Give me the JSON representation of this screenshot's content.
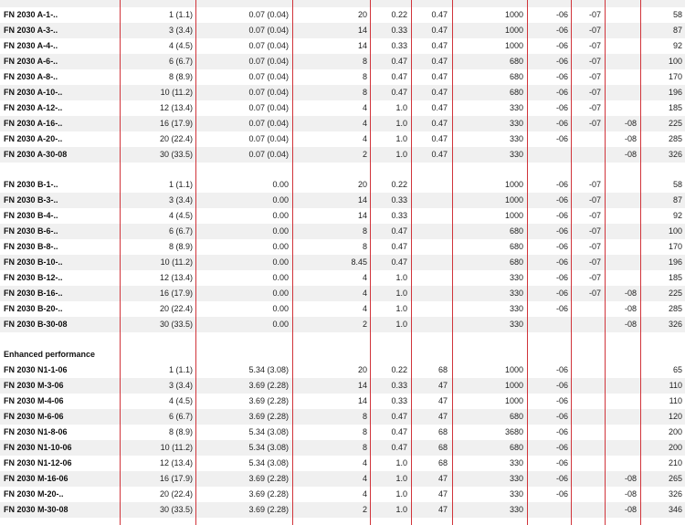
{
  "groups": [
    {
      "heading": "",
      "rows": [
        {
          "name": "FN 2030 A-1-..",
          "c1": "1 (1.1)",
          "c2": "0.07 (0.04)",
          "c3": "20",
          "c4": "0.22",
          "c5": "0.47",
          "c6": "1000",
          "c7": "-06",
          "c8": "-07",
          "c9": "",
          "c10": "58"
        },
        {
          "name": "FN 2030 A-3-..",
          "c1": "3 (3.4)",
          "c2": "0.07 (0.04)",
          "c3": "14",
          "c4": "0.33",
          "c5": "0.47",
          "c6": "1000",
          "c7": "-06",
          "c8": "-07",
          "c9": "",
          "c10": "87"
        },
        {
          "name": "FN 2030 A-4-..",
          "c1": "4 (4.5)",
          "c2": "0.07 (0.04)",
          "c3": "14",
          "c4": "0.33",
          "c5": "0.47",
          "c6": "1000",
          "c7": "-06",
          "c8": "-07",
          "c9": "",
          "c10": "92"
        },
        {
          "name": "FN 2030 A-6-..",
          "c1": "6 (6.7)",
          "c2": "0.07 (0.04)",
          "c3": "8",
          "c4": "0.47",
          "c5": "0.47",
          "c6": "680",
          "c7": "-06",
          "c8": "-07",
          "c9": "",
          "c10": "100"
        },
        {
          "name": "FN 2030 A-8-..",
          "c1": "8 (8.9)",
          "c2": "0.07 (0.04)",
          "c3": "8",
          "c4": "0.47",
          "c5": "0.47",
          "c6": "680",
          "c7": "-06",
          "c8": "-07",
          "c9": "",
          "c10": "170"
        },
        {
          "name": "FN 2030 A-10-..",
          "c1": "10 (11.2)",
          "c2": "0.07 (0.04)",
          "c3": "8",
          "c4": "0.47",
          "c5": "0.47",
          "c6": "680",
          "c7": "-06",
          "c8": "-07",
          "c9": "",
          "c10": "196"
        },
        {
          "name": "FN 2030 A-12-..",
          "c1": "12 (13.4)",
          "c2": "0.07 (0.04)",
          "c3": "4",
          "c4": "1.0",
          "c5": "0.47",
          "c6": "330",
          "c7": "-06",
          "c8": "-07",
          "c9": "",
          "c10": "185"
        },
        {
          "name": "FN 2030 A-16-..",
          "c1": "16 (17.9)",
          "c2": "0.07 (0.04)",
          "c3": "4",
          "c4": "1.0",
          "c5": "0.47",
          "c6": "330",
          "c7": "-06",
          "c8": "-07",
          "c9": "-08",
          "c10": "225"
        },
        {
          "name": "FN 2030 A-20-..",
          "c1": "20 (22.4)",
          "c2": "0.07 (0.04)",
          "c3": "4",
          "c4": "1.0",
          "c5": "0.47",
          "c6": "330",
          "c7": "-06",
          "c8": "",
          "c9": "-08",
          "c10": "285"
        },
        {
          "name": "FN 2030 A-30-08",
          "c1": "30 (33.5)",
          "c2": "0.07 (0.04)",
          "c3": "2",
          "c4": "1.0",
          "c5": "0.47",
          "c6": "330",
          "c7": "",
          "c8": "",
          "c9": "-08",
          "c10": "326"
        }
      ]
    },
    {
      "heading": "",
      "rows": [
        {
          "name": "FN 2030 B-1-..",
          "c1": "1 (1.1)",
          "c2": "0.00",
          "c3": "20",
          "c4": "0.22",
          "c5": "",
          "c6": "1000",
          "c7": "-06",
          "c8": "-07",
          "c9": "",
          "c10": "58"
        },
        {
          "name": "FN 2030 B-3-..",
          "c1": "3 (3.4)",
          "c2": "0.00",
          "c3": "14",
          "c4": "0.33",
          "c5": "",
          "c6": "1000",
          "c7": "-06",
          "c8": "-07",
          "c9": "",
          "c10": "87"
        },
        {
          "name": "FN 2030 B-4-..",
          "c1": "4 (4.5)",
          "c2": "0.00",
          "c3": "14",
          "c4": "0.33",
          "c5": "",
          "c6": "1000",
          "c7": "-06",
          "c8": "-07",
          "c9": "",
          "c10": "92"
        },
        {
          "name": "FN 2030 B-6-..",
          "c1": "6 (6.7)",
          "c2": "0.00",
          "c3": "8",
          "c4": "0.47",
          "c5": "",
          "c6": "680",
          "c7": "-06",
          "c8": "-07",
          "c9": "",
          "c10": "100"
        },
        {
          "name": "FN 2030 B-8-..",
          "c1": "8 (8.9)",
          "c2": "0.00",
          "c3": "8",
          "c4": "0.47",
          "c5": "",
          "c6": "680",
          "c7": "-06",
          "c8": "-07",
          "c9": "",
          "c10": "170"
        },
        {
          "name": "FN 2030 B-10-..",
          "c1": "10 (11.2)",
          "c2": "0.00",
          "c3": "8.45",
          "c4": "0.47",
          "c5": "",
          "c6": "680",
          "c7": "-06",
          "c8": "-07",
          "c9": "",
          "c10": "196"
        },
        {
          "name": "FN 2030 B-12-..",
          "c1": "12 (13.4)",
          "c2": "0.00",
          "c3": "4",
          "c4": "1.0",
          "c5": "",
          "c6": "330",
          "c7": "-06",
          "c8": "-07",
          "c9": "",
          "c10": "185"
        },
        {
          "name": "FN 2030 B-16-..",
          "c1": "16 (17.9)",
          "c2": "0.00",
          "c3": "4",
          "c4": "1.0",
          "c5": "",
          "c6": "330",
          "c7": "-06",
          "c8": "-07",
          "c9": "-08",
          "c10": "225"
        },
        {
          "name": "FN 2030 B-20-..",
          "c1": "20 (22.4)",
          "c2": "0.00",
          "c3": "4",
          "c4": "1.0",
          "c5": "",
          "c6": "330",
          "c7": "-06",
          "c8": "",
          "c9": "-08",
          "c10": "285"
        },
        {
          "name": "FN 2030 B-30-08",
          "c1": "30 (33.5)",
          "c2": "0.00",
          "c3": "2",
          "c4": "1.0",
          "c5": "",
          "c6": "330",
          "c7": "",
          "c8": "",
          "c9": "-08",
          "c10": "326"
        }
      ]
    },
    {
      "heading": "Enhanced performance",
      "rows": [
        {
          "name": "FN 2030 N1-1-06",
          "c1": "1 (1.1)",
          "c2": "5.34 (3.08)",
          "c3": "20",
          "c4": "0.22",
          "c5": "68",
          "c6": "1000",
          "c7": "-06",
          "c8": "",
          "c9": "",
          "c10": "65"
        },
        {
          "name": "FN 2030 M-3-06",
          "c1": "3 (3.4)",
          "c2": "3.69 (2.28)",
          "c3": "14",
          "c4": "0.33",
          "c5": "47",
          "c6": "1000",
          "c7": "-06",
          "c8": "",
          "c9": "",
          "c10": "110"
        },
        {
          "name": "FN 2030 M-4-06",
          "c1": "4 (4.5)",
          "c2": "3.69 (2.28)",
          "c3": "14",
          "c4": "0.33",
          "c5": "47",
          "c6": "1000",
          "c7": "-06",
          "c8": "",
          "c9": "",
          "c10": "110"
        },
        {
          "name": "FN 2030 M-6-06",
          "c1": "6 (6.7)",
          "c2": "3.69 (2.28)",
          "c3": "8",
          "c4": "0.47",
          "c5": "47",
          "c6": "680",
          "c7": "-06",
          "c8": "",
          "c9": "",
          "c10": "120"
        },
        {
          "name": "FN 2030 N1-8-06",
          "c1": "8 (8.9)",
          "c2": "5.34 (3.08)",
          "c3": "8",
          "c4": "0.47",
          "c5": "68",
          "c6": "3680",
          "c7": "-06",
          "c8": "",
          "c9": "",
          "c10": "200"
        },
        {
          "name": "FN 2030 N1-10-06",
          "c1": "10 (11.2)",
          "c2": "5.34 (3.08)",
          "c3": "8",
          "c4": "0.47",
          "c5": "68",
          "c6": "680",
          "c7": "-06",
          "c8": "",
          "c9": "",
          "c10": "200"
        },
        {
          "name": "FN 2030 N1-12-06",
          "c1": "12 (13.4)",
          "c2": "5.34 (3.08)",
          "c3": "4",
          "c4": "1.0",
          "c5": "68",
          "c6": "330",
          "c7": "-06",
          "c8": "",
          "c9": "",
          "c10": "210"
        },
        {
          "name": "FN 2030 M-16-06",
          "c1": "16 (17.9)",
          "c2": "3.69 (2.28)",
          "c3": "4",
          "c4": "1.0",
          "c5": "47",
          "c6": "330",
          "c7": "-06",
          "c8": "",
          "c9": "-08",
          "c10": "265"
        },
        {
          "name": "FN 2030 M-20-..",
          "c1": "20 (22.4)",
          "c2": "3.69 (2.28)",
          "c3": "4",
          "c4": "1.0",
          "c5": "47",
          "c6": "330",
          "c7": "-06",
          "c8": "",
          "c9": "-08",
          "c10": "326"
        },
        {
          "name": "FN 2030 M-30-08",
          "c1": "30 (33.5)",
          "c2": "3.69 (2.28)",
          "c3": "2",
          "c4": "1.0",
          "c5": "47",
          "c6": "330",
          "c7": "",
          "c8": "",
          "c9": "-08",
          "c10": "346"
        }
      ]
    }
  ]
}
